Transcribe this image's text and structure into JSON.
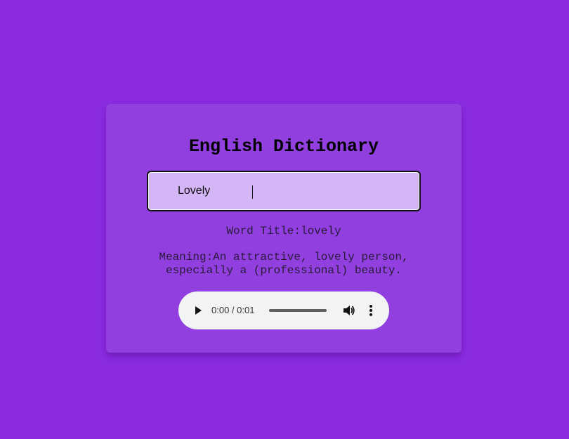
{
  "app": {
    "title": "English Dictionary"
  },
  "search": {
    "value": "Lovely",
    "placeholder": ""
  },
  "result": {
    "word_title": "Word Title:lovely",
    "meaning": "Meaning:An attractive, lovely person, especially a (professional) beauty."
  },
  "audio": {
    "time": "0:00 / 0:01",
    "progress": 0,
    "icons": {
      "play": "play-icon",
      "volume": "volume-icon",
      "more": "more-vertical-icon"
    }
  },
  "colors": {
    "background": "#8a2be2",
    "card": "#9140df",
    "input": "#d4b5f5",
    "player": "#f1f3f4"
  }
}
